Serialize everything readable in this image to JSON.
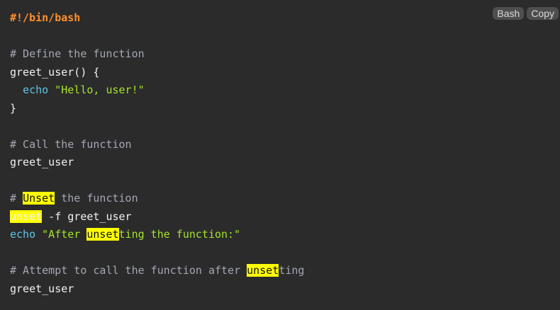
{
  "toolbar": {
    "language_label": "Bash",
    "copy_label": "Copy"
  },
  "code": {
    "l1": "#!/bin/bash",
    "l3": "# Define the function",
    "l4": "greet_user() {",
    "l5_builtin": "echo",
    "l5_string": "\"Hello, user!\"",
    "l6": "}",
    "l8": "# Call the function",
    "l9": "greet_user",
    "l11_pre": "# ",
    "l11_mark": "Unset",
    "l11_post": " the function",
    "l12_mark": "unset",
    "l12_post": " -f greet_user",
    "l13_builtin": "echo",
    "l13_str_pre": "\"After ",
    "l13_mark": "unset",
    "l13_str_post": "ting the function:\"",
    "l15_pre": "# Attempt to call the function after ",
    "l15_mark": "unset",
    "l15_post": "ting",
    "l16": "greet_user"
  },
  "colors": {
    "background": "#2b2b2b",
    "highlight": "#ffff00",
    "shebang": "#ff8f2e",
    "comment": "#a4a8b3",
    "builtin": "#5fc6e8",
    "string": "#a6e22e"
  }
}
